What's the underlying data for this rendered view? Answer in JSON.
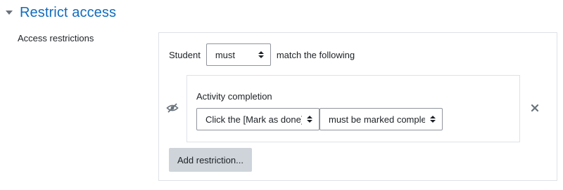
{
  "section": {
    "title": "Restrict access"
  },
  "form": {
    "label": "Access restrictions"
  },
  "restrictions": {
    "student_label": "Student",
    "must_select": "must",
    "match_text": "match the following",
    "condition": {
      "title": "Activity completion",
      "activity": "Click the [Mark as done] button",
      "completion": "must be marked complete"
    },
    "add_button": "Add restriction..."
  },
  "icons": {
    "caret": "caret-down-icon",
    "eye": "eye-slash-icon",
    "close": "close-icon",
    "select_arrows": "updown-icon"
  },
  "colors": {
    "title": "#0f6cbf",
    "button_bg": "#ced4da",
    "border": "#dee2e6"
  }
}
